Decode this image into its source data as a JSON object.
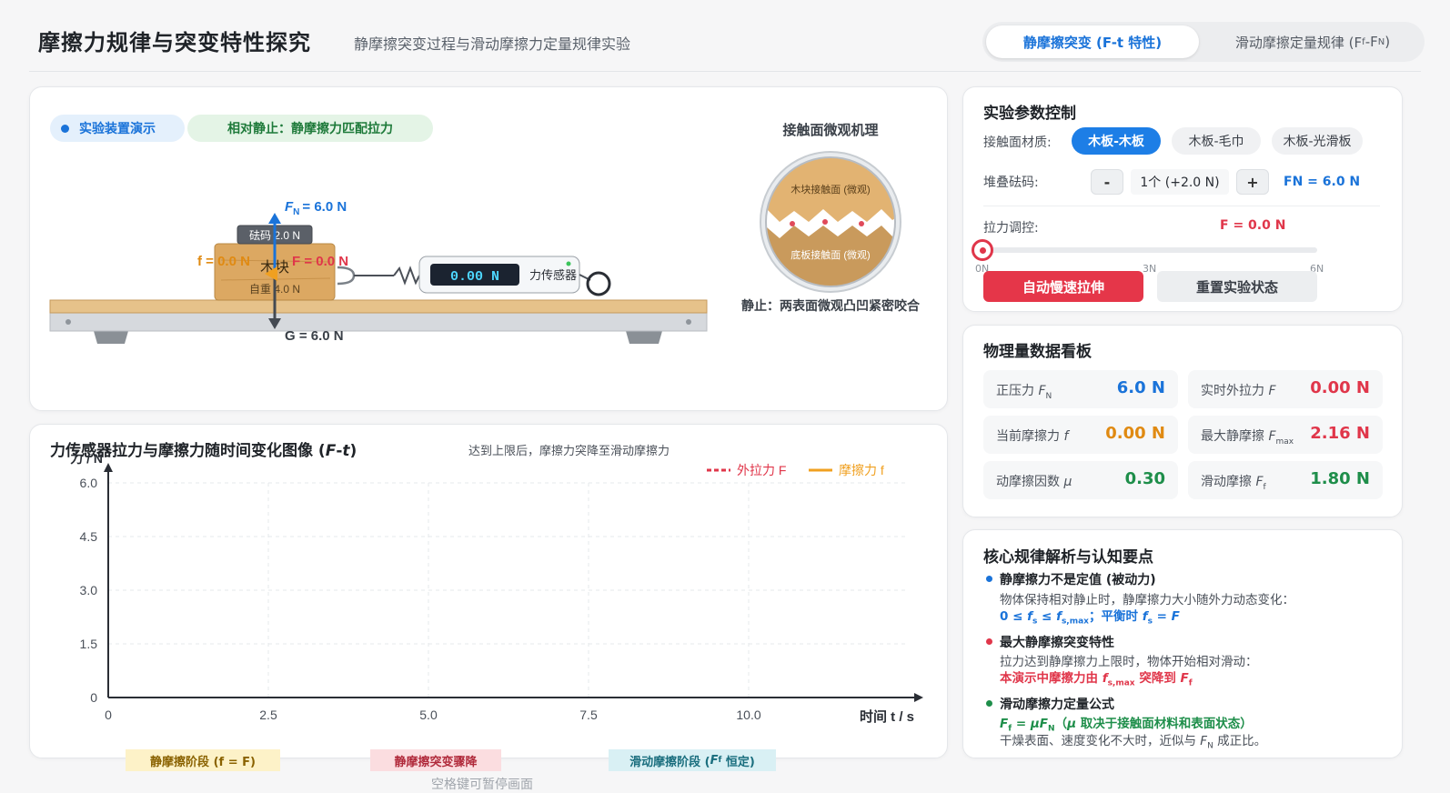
{
  "header": {
    "title": "摩擦力规律与突变特性探究",
    "subtitle": "静摩擦突变过程与滑动摩擦力定量规律实验",
    "tabs": [
      {
        "label": "静摩擦突变 (F-t 特性)",
        "active": true
      },
      {
        "label": "滑动摩擦定量规律 (Ff-FN)",
        "active": false
      }
    ]
  },
  "apparatus": {
    "demo_badge": "实验装置演示",
    "state_badge": "相对静止：静摩擦力匹配拉力",
    "weight_label": "砝码 2.0 N",
    "block_label": "木块",
    "self_weight": "自重 4.0 N",
    "fn_label": "F",
    "fn_sub": "N",
    "fn_value": "= 6.0 N",
    "f_label": "f = 0.0 N",
    "F_label": "F = 0.0 N",
    "g_label": "G = 6.0 N",
    "sensor_reading": "0.00 N",
    "sensor_label": "力传感器",
    "micro_title": "接触面微观机理",
    "micro_top": "木块接触面 (微观)",
    "micro_bottom": "底板接触面 (微观)",
    "micro_caption": "静止：两表面微观凸凹紧密咬合"
  },
  "controls": {
    "title": "实验参数控制",
    "material_label": "接触面材质:",
    "materials": [
      "木板-木板",
      "木板-毛巾",
      "木板-光滑板"
    ],
    "material_selected": "木板-木板",
    "weights_label": "堆叠砝码:",
    "minus": "-",
    "plus": "+",
    "weights_value": "1个 (+2.0 N)",
    "fn_readout": "FN = 6.0 N",
    "pull_label": "拉力调控:",
    "pull_value": "F = 0.0 N",
    "slider_value": 0,
    "slider_ticks": [
      "0N",
      "3N",
      "6N"
    ],
    "auto_button": "自动慢速拉伸",
    "reset_button": "重置实验状态"
  },
  "dashboard": {
    "title": "物理量数据看板",
    "items": [
      {
        "key": "正压力 ",
        "var": "F",
        "sub": "N",
        "value": "6.0 N",
        "color": "#1a73d9"
      },
      {
        "key": "实时外拉力 ",
        "var": "F",
        "sub": "",
        "value": "0.00 N",
        "color": "#e0364a"
      },
      {
        "key": "当前摩擦力 ",
        "var": "f",
        "sub": "",
        "value": "0.00 N",
        "color": "#e08a12"
      },
      {
        "key": "最大静摩擦 ",
        "var": "F",
        "sub": "max",
        "value": "2.16 N",
        "color": "#e0364a"
      },
      {
        "key": "动摩擦因数 ",
        "var": "μ",
        "sub": "",
        "value": "0.30",
        "color": "#1e8e4a"
      },
      {
        "key": "滑动摩擦 ",
        "var": "F",
        "sub": "f",
        "value": "1.80 N",
        "color": "#1e8e4a"
      }
    ]
  },
  "rules": {
    "title": "核心规律解析与认知要点",
    "items": [
      {
        "title": "静摩擦力不是定值 (被动力)",
        "line1": "物体保持相对静止时，静摩擦力大小随外力动态变化：",
        "line2": "0 ≤ fs ≤ fs,max；平衡时 fs = F",
        "color": "#1a73d9"
      },
      {
        "title": "最大静摩擦突变特性",
        "line1": "拉力达到静摩擦力上限时，物体开始相对滑动：",
        "line2": "本演示中摩擦力由 fs,max 突降到 Ff",
        "color": "#e0364a"
      },
      {
        "title": "滑动摩擦力定量公式",
        "line1": "Ff = μFN（μ 取决于接触面材料和表面状态）",
        "line2": "干燥表面、速度变化不大时，近似与 FN 成正比。",
        "color": "#1e8e4a"
      }
    ]
  },
  "chart_data": {
    "type": "line",
    "title": "力传感器拉力与摩擦力随时间变化图像 (F-t)",
    "annotation": "达到上限后，摩擦力突降至滑动摩擦力",
    "xlabel": "时间 t / s",
    "ylabel": "力 / N",
    "xlim": [
      0,
      12.5
    ],
    "ylim": [
      0,
      6.0
    ],
    "x_ticks": [
      "0",
      "2.5",
      "5.0",
      "7.5",
      "10.0"
    ],
    "y_ticks": [
      "0",
      "1.5",
      "3.0",
      "4.5",
      "6.0"
    ],
    "grid": true,
    "legend_position": "top-right",
    "series": [
      {
        "name": "外拉力 F",
        "color": "#e0364a",
        "dashed": true,
        "points": []
      },
      {
        "name": "摩擦力 f",
        "color": "#f0a020",
        "dashed": false,
        "points": []
      }
    ],
    "stages": [
      {
        "label": "静摩擦阶段 (f = F)",
        "bg": "#fdf2c8",
        "color": "#8a6200"
      },
      {
        "label": "静摩擦突变骤降",
        "bg": "#fbdde0",
        "color": "#b0293a"
      },
      {
        "label": "滑动摩擦阶段 (Ff 恒定)",
        "bg": "#d9f0f4",
        "color": "#1a6e7e"
      }
    ]
  },
  "footer_hint": "空格键可暂停画面"
}
